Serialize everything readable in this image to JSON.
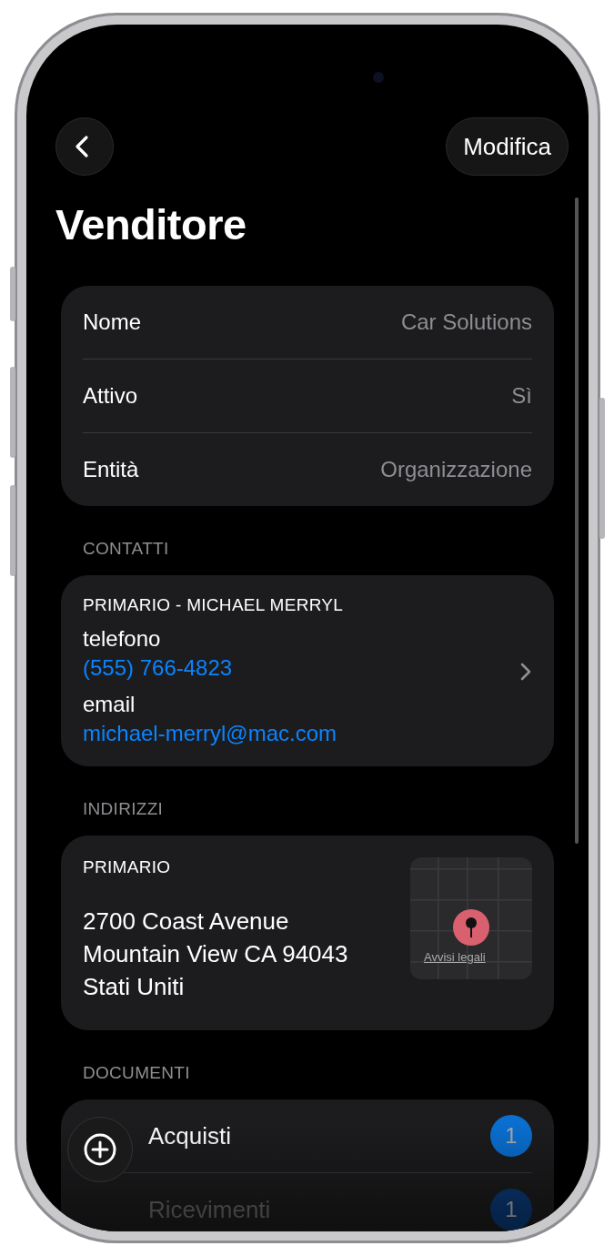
{
  "navigation": {
    "edit_button": "Modifica"
  },
  "title": "Venditore",
  "details": [
    {
      "label": "Nome",
      "value": "Car Solutions"
    },
    {
      "label": "Attivo",
      "value": "Sì"
    },
    {
      "label": "Entità",
      "value": "Organizzazione"
    }
  ],
  "contacts": {
    "header": "CONTATTI",
    "items": [
      {
        "title": "PRIMARIO - MICHAEL MERRYL",
        "phone_label": "telefono",
        "phone": "(555) 766-4823",
        "email_label": "email",
        "email": "michael-merryl@mac.com"
      }
    ]
  },
  "addresses": {
    "header": "INDIRIZZI",
    "items": [
      {
        "title": "PRIMARIO",
        "lines": [
          "2700 Coast Avenue",
          "Mountain View CA 94043",
          "Stati Uniti"
        ],
        "map": {
          "kind": "picture",
          "legal_link": "Avvisi legali"
        }
      }
    ]
  },
  "documents": {
    "header": "DOCUMENTI",
    "items": [
      {
        "label": "Acquisti",
        "count": "1"
      },
      {
        "label": "Ricevimenti",
        "count": "1"
      }
    ]
  }
}
